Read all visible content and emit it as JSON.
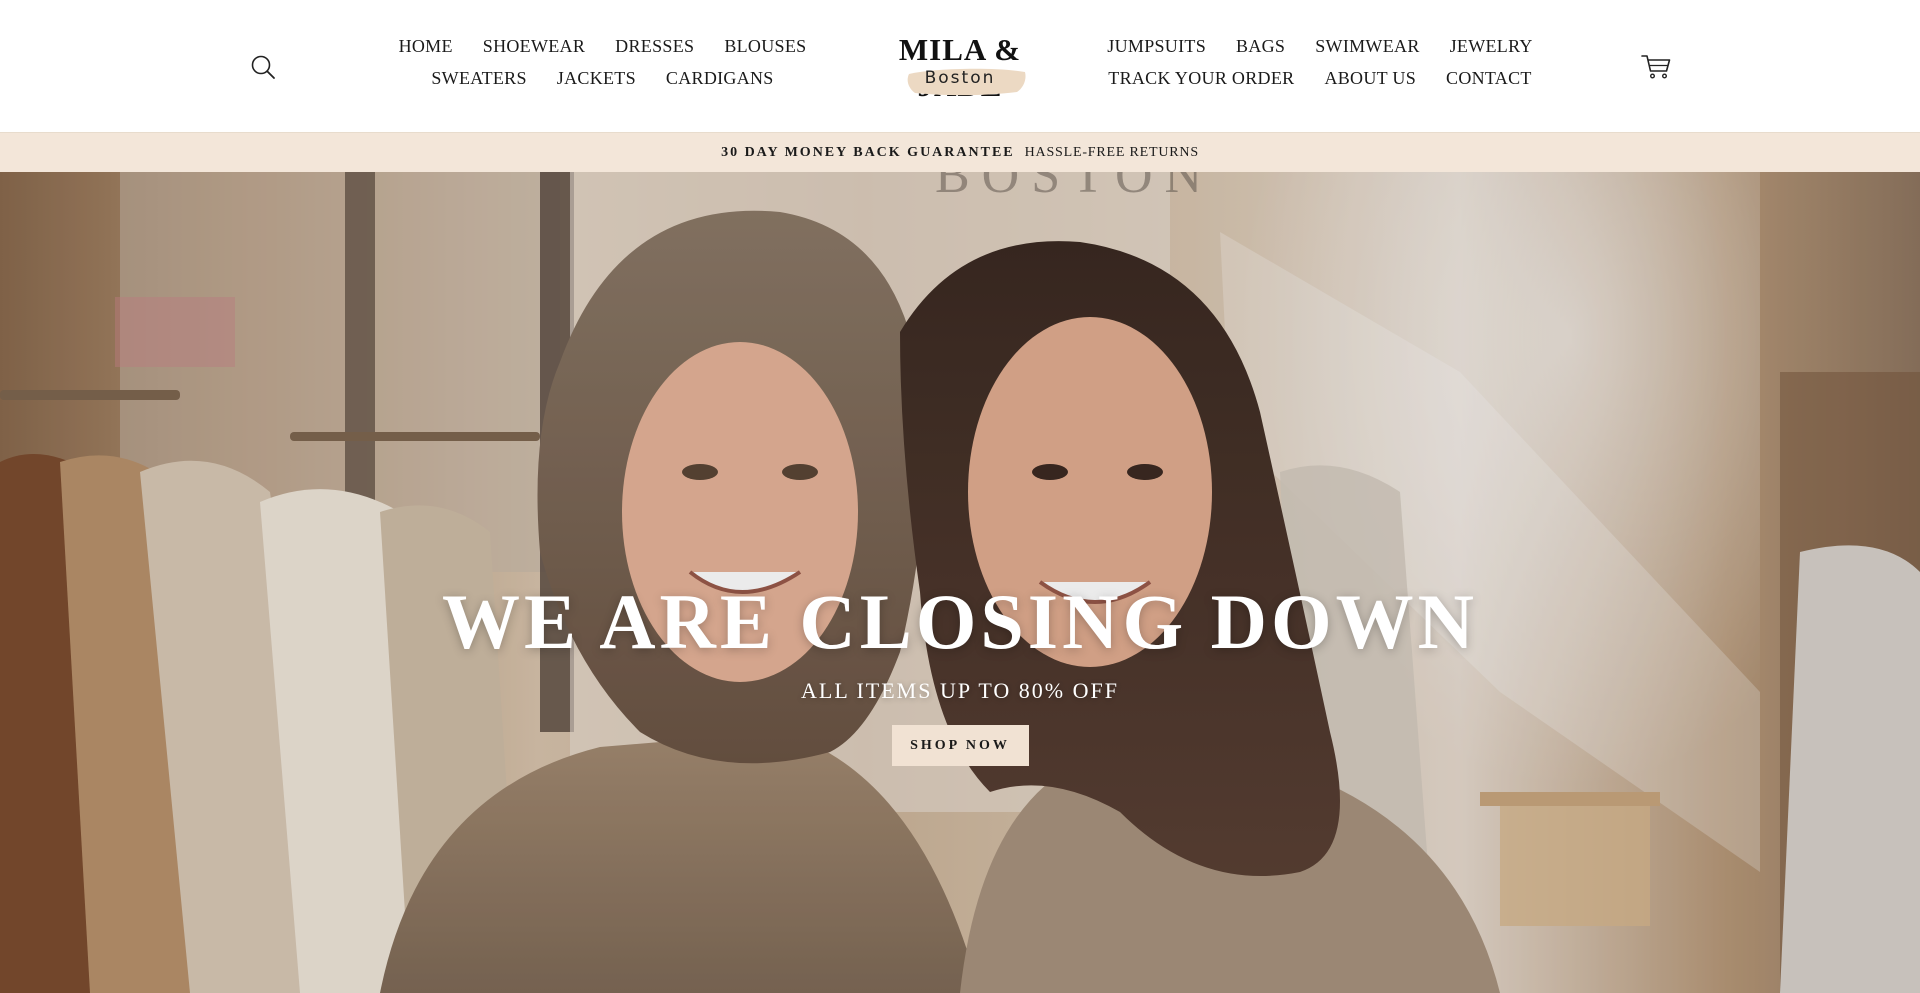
{
  "header": {
    "nav_left": {
      "row1": [
        "HOME",
        "SHOEWEAR",
        "DRESSES",
        "BLOUSES"
      ],
      "row2": [
        "SWEATERS",
        "JACKETS",
        "CARDIGANS"
      ]
    },
    "nav_right": {
      "row1": [
        "JUMPSUITS",
        "BAGS",
        "SWIMWEAR",
        "JEWELRY"
      ],
      "row2": [
        "TRACK YOUR ORDER",
        "ABOUT US",
        "CONTACT"
      ]
    },
    "logo": {
      "name": "MILA & JADE",
      "city": "Boston"
    },
    "icons": {
      "search": "search-icon",
      "cart": "cart-icon"
    }
  },
  "announcement": {
    "strong": "30 DAY MONEY BACK GUARANTEE",
    "rest": "HASSLE-FREE RETURNS"
  },
  "hero": {
    "title": "WE ARE CLOSING DOWN",
    "subtitle": "ALL ITEMS UP TO 80% OFF",
    "button": "SHOP NOW",
    "wall_sign": "BOSTON"
  },
  "colors": {
    "announcement_bg": "#f3e6d9",
    "button_bg": "#f1e2d3",
    "text": "#1a1a1a"
  }
}
